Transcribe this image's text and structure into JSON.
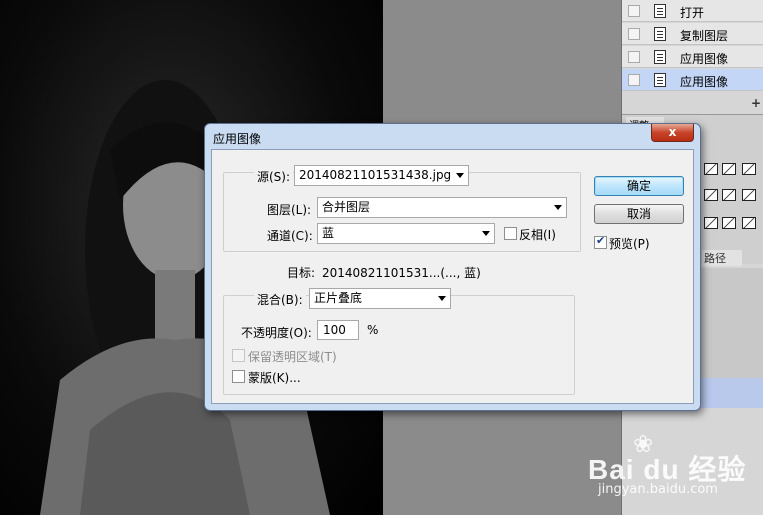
{
  "history_panel": {
    "items": [
      {
        "label": "打开",
        "selected": false
      },
      {
        "label": "复制图层",
        "selected": false
      },
      {
        "label": "应用图像",
        "selected": false
      },
      {
        "label": "应用图像",
        "selected": true
      }
    ],
    "adjust_tab": "调整",
    "path_tab": "路径"
  },
  "dialog": {
    "title": "应用图像",
    "close_label": "x",
    "source": {
      "label": "源(S):",
      "value": "20140821101531438.jpg"
    },
    "layer": {
      "label": "图层(L):",
      "value": "合并图层"
    },
    "channel": {
      "label": "通道(C):",
      "value": "蓝"
    },
    "invert": {
      "label": "反相(I)",
      "checked": false
    },
    "target": {
      "label": "目标:",
      "value": "20140821101531...(..., 蓝)"
    },
    "blending": {
      "label": "混合(B):",
      "value": "正片叠底"
    },
    "opacity": {
      "label": "不透明度(O):",
      "value": "100",
      "unit": "%"
    },
    "preserve_transparency": {
      "label": "保留透明区域(T)",
      "checked": false,
      "disabled": true
    },
    "mask": {
      "label": "蒙版(K)...",
      "checked": false
    },
    "ok_label": "确定",
    "cancel_label": "取消",
    "preview": {
      "label": "预览(P)",
      "checked": true
    }
  },
  "watermark": {
    "brand": "Bai du 经验",
    "url": "jingyan.baidu.com"
  }
}
